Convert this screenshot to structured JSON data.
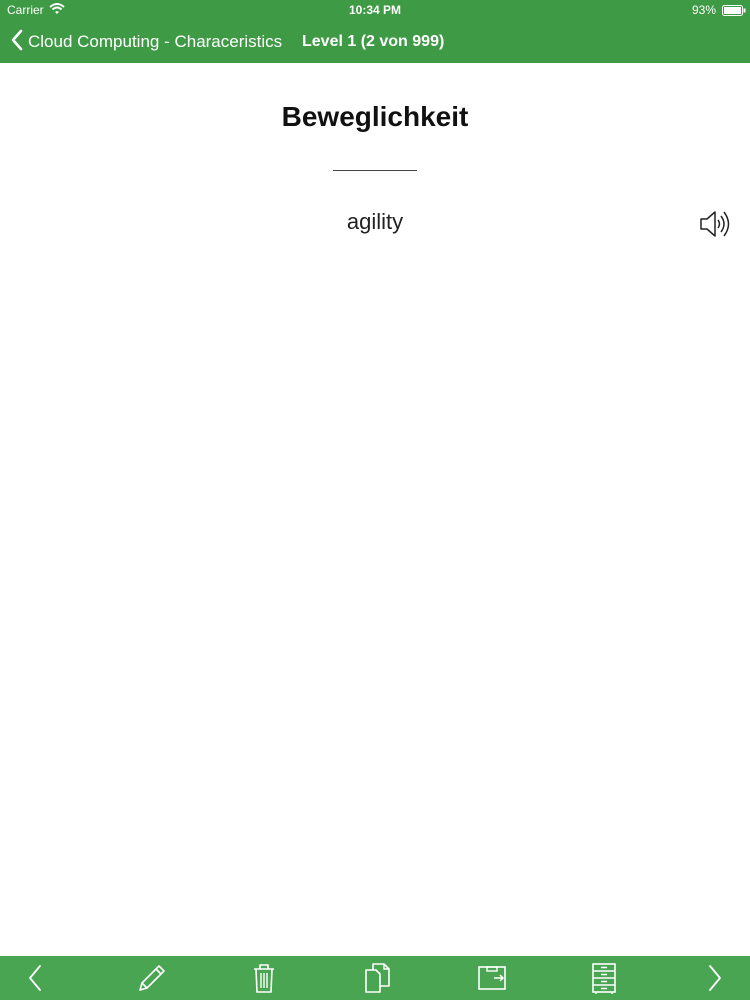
{
  "status_bar": {
    "carrier": "Carrier",
    "time": "10:34 PM",
    "battery": "93%"
  },
  "nav": {
    "back_label": "Cloud Computing - Characeristics",
    "title": "Level 1 (2 von 999)"
  },
  "card": {
    "term": "Beweglichkeit",
    "translation": "agility"
  },
  "colors": {
    "header_green": "#3e9a45",
    "toolbar_green": "#4aa553"
  },
  "toolbar": {
    "icons": [
      "chevron-left-icon",
      "pencil-icon",
      "trash-icon",
      "copy-icon",
      "move-card-icon",
      "cabinet-icon",
      "chevron-right-icon"
    ]
  }
}
